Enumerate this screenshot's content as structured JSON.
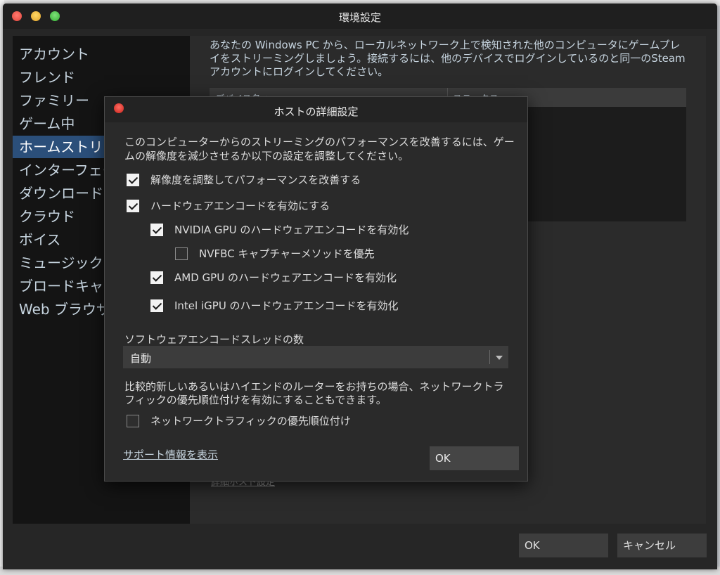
{
  "window": {
    "title": "環境設定"
  },
  "sidebar": {
    "items": [
      {
        "label": "アカウント"
      },
      {
        "label": "フレンド"
      },
      {
        "label": "ファミリー"
      },
      {
        "label": "ゲーム中"
      },
      {
        "label": "ホームストリーミング"
      },
      {
        "label": "インターフェース"
      },
      {
        "label": "ダウンロード"
      },
      {
        "label": "クラウド"
      },
      {
        "label": "ボイス"
      },
      {
        "label": "ミュージック"
      },
      {
        "label": "ブロードキャスト"
      },
      {
        "label": "Web ブラウザ"
      }
    ],
    "active_index": 4
  },
  "content": {
    "description": "あなたの Windows PC から、ローカルネットワーク上で検知された他のコンピュータにゲームプレイをストリーミングしましょう。接続するには、他のデバイスでログインしているのと同一のSteam アカウントにログインしてください。",
    "table": {
      "col_device": "デバイス名 ▲",
      "col_status": "ステータス"
    },
    "link": "詳細ホスト設定"
  },
  "footer": {
    "ok": "OK",
    "cancel": "キャンセル"
  },
  "dialog": {
    "title": "ホストの詳細設定",
    "description": "このコンピューターからのストリーミングのパフォーマンスを改善するには、ゲームの解像度を減少させるか以下の設定を調整してください。",
    "options": [
      {
        "label": "解像度を調整してパフォーマンスを改善する",
        "checked": true
      },
      {
        "label": "ハードウェアエンコードを有効にする",
        "checked": true
      },
      {
        "label": "NVIDIA GPU のハードウェアエンコードを有効化",
        "checked": true
      },
      {
        "label": "NVFBC キャプチャーメソッドを優先",
        "checked": false
      },
      {
        "label": "AMD GPU のハードウェアエンコードを有効化",
        "checked": true
      },
      {
        "label": "Intel iGPU のハードウェアエンコードを有効化",
        "checked": true
      }
    ],
    "threads_label": "ソフトウェアエンコードスレッドの数",
    "threads_value": "自動",
    "network_note": "比較的新しいあるいはハイエンドのルーターをお持ちの場合、ネットワークトラフィックの優先順位付けを有効にすることもできます。",
    "network_option": {
      "label": "ネットワークトラフィックの優先順位付け",
      "checked": false
    },
    "support_link": "サポート情報を表示",
    "ok": "OK"
  }
}
